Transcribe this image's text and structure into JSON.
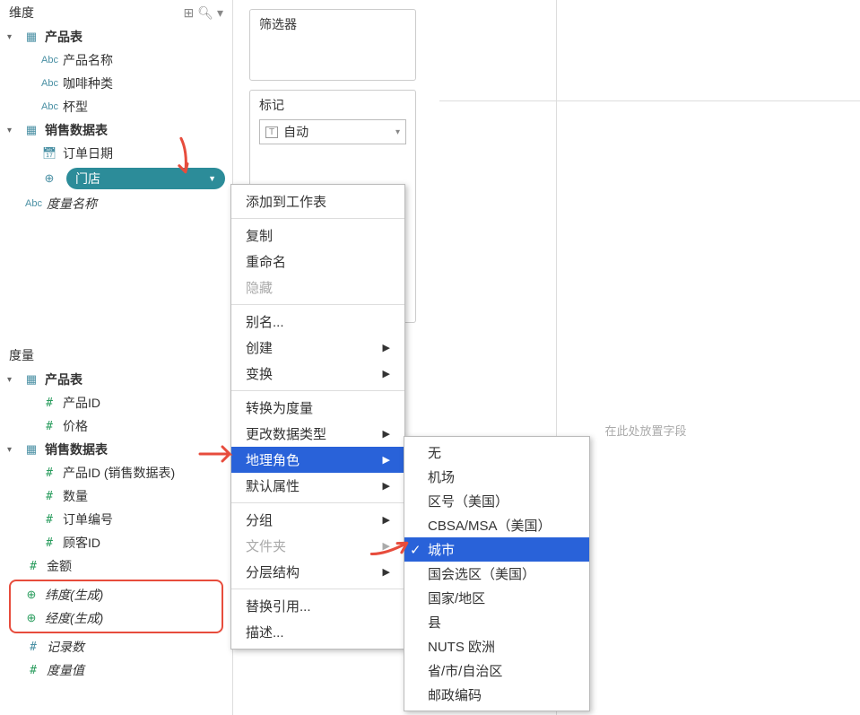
{
  "sidebar": {
    "dimensions_header": "维度",
    "measures_header": "度量",
    "dim_tables": [
      {
        "name": "产品表",
        "fields": [
          {
            "icon": "abc",
            "label": "产品名称"
          },
          {
            "icon": "abc",
            "label": "咖啡种类"
          },
          {
            "icon": "abc",
            "label": "杯型"
          }
        ]
      },
      {
        "name": "销售数据表",
        "fields": [
          {
            "icon": "date",
            "label": "订单日期"
          },
          {
            "icon": "globe",
            "label": "门店",
            "selected": true
          }
        ]
      }
    ],
    "measure_names": "度量名称",
    "measure_tables": [
      {
        "name": "产品表",
        "fields": [
          {
            "icon": "hash",
            "label": "产品ID"
          },
          {
            "icon": "hash",
            "label": "价格"
          }
        ]
      },
      {
        "name": "销售数据表",
        "fields": [
          {
            "icon": "hash",
            "label": "产品ID (销售数据表)"
          },
          {
            "icon": "hash",
            "label": "数量"
          },
          {
            "icon": "hash",
            "label": "订单编号"
          },
          {
            "icon": "hash",
            "label": "顾客ID"
          }
        ]
      }
    ],
    "loose_measures": [
      {
        "icon": "hash",
        "label": "金额"
      }
    ],
    "generated_geo": [
      {
        "icon": "globe-green",
        "label": "纬度(生成)"
      },
      {
        "icon": "globe-green",
        "label": "经度(生成)"
      }
    ],
    "bottom_measures": [
      {
        "icon": "hash-italic",
        "label": "记录数",
        "italic": true
      },
      {
        "icon": "hash",
        "label": "度量值",
        "italic": true
      }
    ]
  },
  "cards": {
    "filter_title": "筛选器",
    "marks_title": "标记",
    "marks_auto": "自动"
  },
  "viz": {
    "drop_hint": "在此处放置字段"
  },
  "menu1": {
    "items": [
      {
        "label": "添加到工作表",
        "type": "item"
      },
      {
        "type": "sep"
      },
      {
        "label": "复制",
        "type": "item"
      },
      {
        "label": "重命名",
        "type": "item"
      },
      {
        "label": "隐藏",
        "type": "item",
        "disabled": true
      },
      {
        "type": "sep"
      },
      {
        "label": "别名...",
        "type": "item"
      },
      {
        "label": "创建",
        "type": "submenu"
      },
      {
        "label": "变换",
        "type": "submenu"
      },
      {
        "type": "sep"
      },
      {
        "label": "转换为度量",
        "type": "item"
      },
      {
        "label": "更改数据类型",
        "type": "submenu"
      },
      {
        "label": "地理角色",
        "type": "submenu",
        "highlighted": true
      },
      {
        "label": "默认属性",
        "type": "submenu"
      },
      {
        "type": "sep"
      },
      {
        "label": "分组",
        "type": "submenu"
      },
      {
        "label": "文件夹",
        "type": "submenu",
        "disabled": true
      },
      {
        "label": "分层结构",
        "type": "submenu"
      },
      {
        "type": "sep"
      },
      {
        "label": "替换引用...",
        "type": "item"
      },
      {
        "label": "描述...",
        "type": "item"
      }
    ]
  },
  "menu2": {
    "items": [
      {
        "label": "无"
      },
      {
        "label": "机场"
      },
      {
        "label": "区号（美国）"
      },
      {
        "label": "CBSA/MSA（美国）"
      },
      {
        "label": "城市",
        "checked": true,
        "highlighted": true
      },
      {
        "label": "国会选区（美国）"
      },
      {
        "label": "国家/地区"
      },
      {
        "label": "县"
      },
      {
        "label": "NUTS 欧洲"
      },
      {
        "label": "省/市/自治区"
      },
      {
        "label": "邮政编码"
      }
    ]
  }
}
